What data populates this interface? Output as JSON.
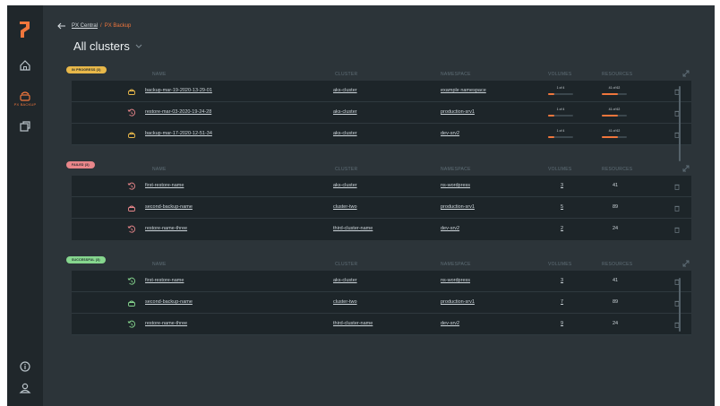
{
  "app": {
    "breadcrumb": {
      "parent": "PX Central",
      "separator": "/",
      "current": "PX Backup"
    },
    "title": "All clusters",
    "rail": {
      "active_label": "PX BACKUP"
    }
  },
  "colors": {
    "accent": "#f0763c",
    "in_progress": "#e8b84a",
    "failed": "#e8868a",
    "successful": "#86d68e"
  },
  "columns": {
    "name": "NAME",
    "cluster": "CLUSTER",
    "namespace": "NAMESPACE",
    "volumes": "VOLUMES",
    "resources": "RESOURCES"
  },
  "sections": [
    {
      "badge": "IN PROGRESS (3)",
      "rows": [
        {
          "icon": "backup-icon",
          "name": "backup-mar-19-2020-13-29-01",
          "cluster": "aks-cluster",
          "namespace": "example namespace",
          "volumes_text": "1 of 4",
          "volumes_progress": 0.25,
          "resources_text": "41 of 62",
          "resources_progress": 0.66
        },
        {
          "icon": "restore-icon",
          "name": "restore-mar-03-2020-19-24-28",
          "cluster": "aks-cluster",
          "namespace": "production-srv1",
          "volumes_text": "1 of 4",
          "volumes_progress": 0.25,
          "resources_text": "41 of 62",
          "resources_progress": 0.66
        },
        {
          "icon": "backup-icon",
          "name": "backup-mar-17-2020-12-51-34",
          "cluster": "aks-cluster",
          "namespace": "dev-srv2",
          "volumes_text": "1 of 4",
          "volumes_progress": 0.25,
          "resources_text": "41 of 62",
          "resources_progress": 0.66
        }
      ]
    },
    {
      "badge": "FAILED (3)",
      "rows": [
        {
          "icon": "restore-icon",
          "name": "first-restore-name",
          "cluster": "aks-cluster",
          "namespace": "ns-wordpress",
          "volumes": "3",
          "resources": "41"
        },
        {
          "icon": "backup-icon",
          "name": "second-backup-name",
          "cluster": "cluster-two",
          "namespace": "production-srv1",
          "volumes": "5",
          "resources": "89"
        },
        {
          "icon": "restore-icon",
          "name": "restore-name-three",
          "cluster": "third-cluster-name",
          "namespace": "dev-srv2",
          "volumes": "2",
          "resources": "24"
        }
      ]
    },
    {
      "badge": "SUCCESSFUL (3)",
      "rows": [
        {
          "icon": "restore-icon",
          "name": "first-restore-name",
          "cluster": "aks-cluster",
          "namespace": "ns-wordpress",
          "volumes": "3",
          "resources": "41"
        },
        {
          "icon": "backup-icon",
          "name": "second-backup-name",
          "cluster": "cluster-two",
          "namespace": "production-srv1",
          "volumes": "7",
          "resources": "89"
        },
        {
          "icon": "restore-icon",
          "name": "restore-name-three",
          "cluster": "third-cluster-name",
          "namespace": "dev-srv2",
          "volumes": "9",
          "resources": "24"
        }
      ]
    }
  ]
}
